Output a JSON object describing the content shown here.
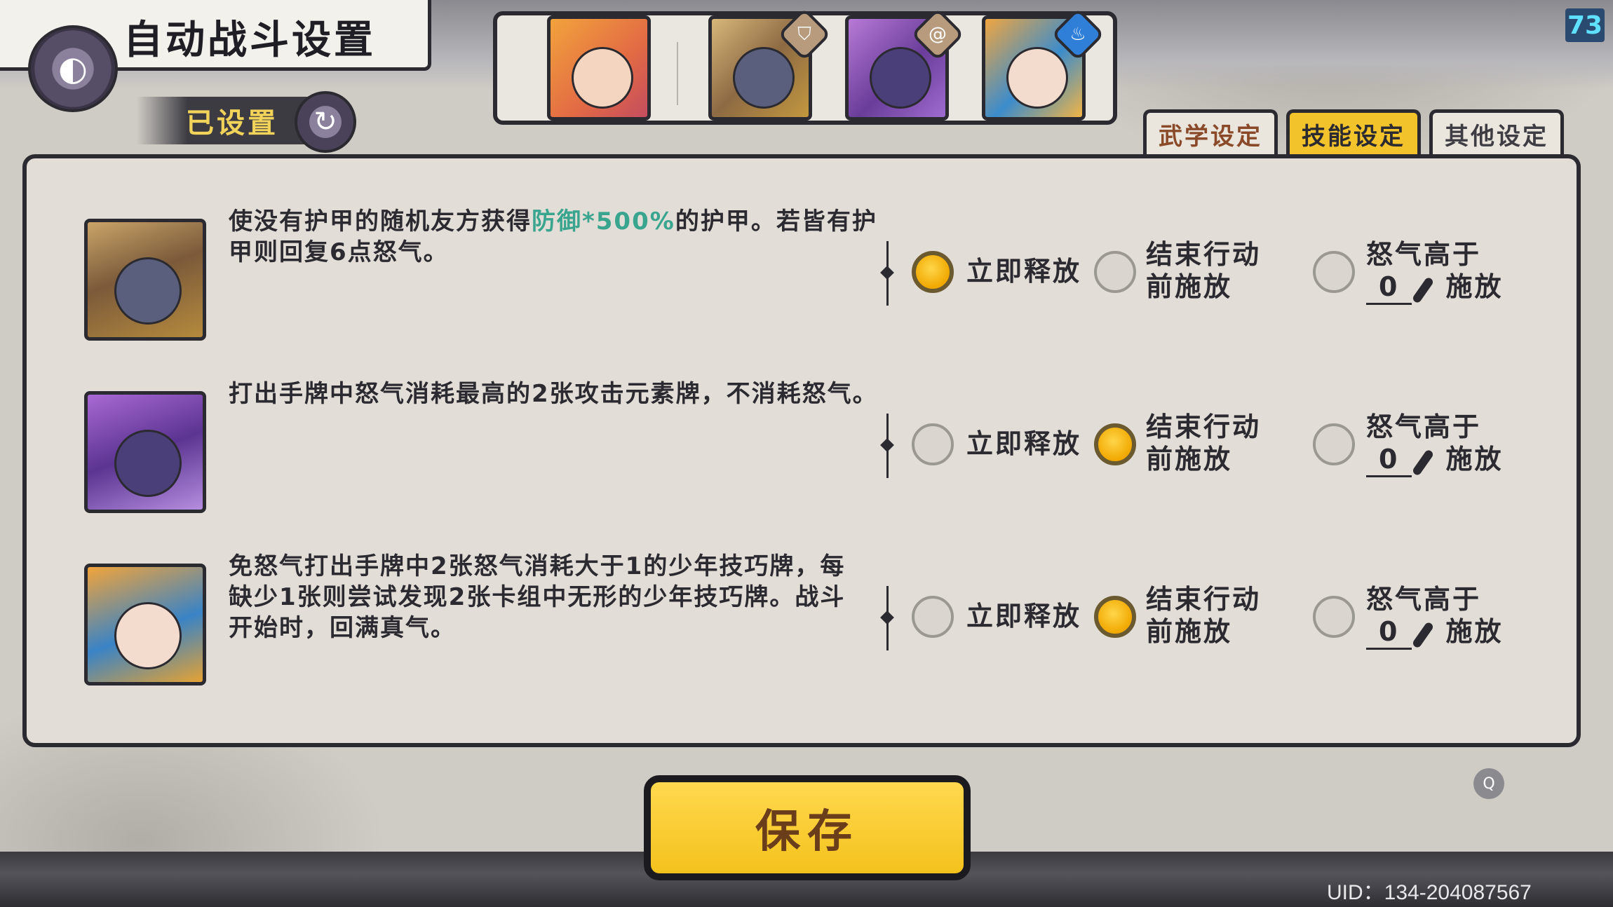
{
  "header": {
    "title": "自动战斗设置",
    "back_icon": "back-swirl-icon",
    "status_label": "已设置",
    "level": "73"
  },
  "team": [
    {
      "name": "hero-portrait"
    },
    {
      "name": "rock-golem-portrait",
      "badge": "shield-icon"
    },
    {
      "name": "purple-beast-portrait",
      "badge": "spiral-icon"
    },
    {
      "name": "blue-hair-boy-portrait",
      "badge": "water-icon"
    }
  ],
  "tabs": [
    {
      "label": "武学设定",
      "active": false
    },
    {
      "label": "技能设定",
      "active": true
    },
    {
      "label": "其他设定",
      "active": false
    }
  ],
  "options": {
    "immediate": "立即释放",
    "end_turn_line1": "结束行动",
    "end_turn_line2": "前施放",
    "threshold_line1": "怒气高于",
    "threshold_suffix": "施放"
  },
  "skills": [
    {
      "desc_pre": "使没有护甲的随机友方获得",
      "desc_hl": "防御*500%",
      "desc_post": "的护甲。若皆有护甲则回复6点怒气。",
      "selected": "immediate",
      "threshold": "0"
    },
    {
      "desc_pre": "打出手牌中怒气消耗最高的2张攻击元素牌，不消耗怒气。",
      "desc_hl": "",
      "desc_post": "",
      "selected": "end_turn",
      "threshold": "0"
    },
    {
      "desc_pre": "免怒气打出手牌中2张怒气消耗大于1的少年技巧牌，每缺少1张则尝试发现2张卡组中无形的少年技巧牌。战斗开始时，回满真气。",
      "desc_hl": "",
      "desc_post": "",
      "selected": "end_turn",
      "threshold": "0"
    }
  ],
  "save_label": "保存",
  "uid": "UID：134-204087567",
  "colors": {
    "accent_yellow": "#f3c32c",
    "highlight_green": "#3aa58e",
    "dark_border": "#2b2a30"
  }
}
